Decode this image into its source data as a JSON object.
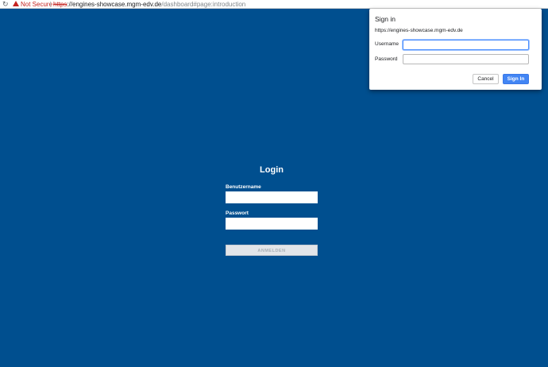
{
  "browser": {
    "reload_icon": "reload-icon",
    "security_status": "Not Secure",
    "url_scheme": "https",
    "url_host": "://engines-showcase.mgm-edv.de",
    "url_path": "/dashboard#page:introduction"
  },
  "login": {
    "title": "Login",
    "username_label": "Benutzername",
    "username_value": "",
    "password_label": "Passwort",
    "password_value": "",
    "submit_label": "ANMELDEN"
  },
  "signin_dialog": {
    "title": "Sign in",
    "url": "https://engines-showcase.mgm-edv.de",
    "username_label": "Username",
    "username_value": "",
    "password_label": "Password",
    "password_value": "",
    "cancel_label": "Cancel",
    "signin_label": "Sign In"
  },
  "colors": {
    "background": "#004f8f",
    "accent": "#4285f4",
    "warning": "#c5221f"
  }
}
